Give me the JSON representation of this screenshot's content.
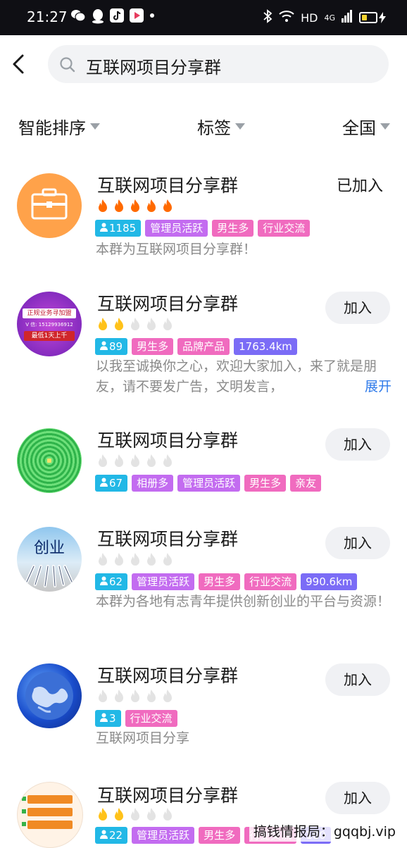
{
  "status": {
    "time": "21:27",
    "right_icons": [
      "bluetooth-icon",
      "wifi-icon",
      "HD",
      "4G",
      "signal-icon",
      "battery-icon"
    ],
    "battery_level": 0.4
  },
  "search": {
    "query": "互联网项目分享群"
  },
  "filters": [
    {
      "label": "智能排序"
    },
    {
      "label": "标签"
    },
    {
      "label": "全国"
    }
  ],
  "groups": [
    {
      "title": "互联网项目分享群",
      "fires_active": 5,
      "fire_color": "#ff6a00",
      "count": "1185",
      "tags": [
        {
          "text": "管理员活跃",
          "color": "#c36cf0"
        },
        {
          "text": "男生多",
          "color": "#f06bbf"
        },
        {
          "text": "行业交流",
          "color": "#f06bbf"
        }
      ],
      "desc": "本群为互联网项目分享群！",
      "action": "已加入"
    },
    {
      "title": "互联网项目分享群",
      "fires_active": 2,
      "fire_color": "#ffc21a",
      "count": "89",
      "tags": [
        {
          "text": "男生多",
          "color": "#f06bbf"
        },
        {
          "text": "品牌产品",
          "color": "#f06bbf"
        },
        {
          "text": "1763.4km",
          "color": "#7b6cf6"
        }
      ],
      "desc": "以我至诚换你之心，欢迎大家加入，来了就是朋友，请不要发广告，文明发言，",
      "expand": "展开",
      "action": "加入",
      "avatar_text": {
        "line1": "正规业务寻加盟",
        "line2": "V 信: 15129936912",
        "line3": "最低1天上千"
      }
    },
    {
      "title": "互联网项目分享群",
      "fires_active": 0,
      "fire_color": "#ffc21a",
      "count": "67",
      "tags": [
        {
          "text": "相册多",
          "color": "#c36cf0"
        },
        {
          "text": "管理员活跃",
          "color": "#c36cf0"
        },
        {
          "text": "男生多",
          "color": "#f06bbf"
        },
        {
          "text": "亲友",
          "color": "#f06bbf"
        }
      ],
      "desc": "",
      "action": "加入"
    },
    {
      "title": "互联网项目分享群",
      "fires_active": 0,
      "fire_color": "#ffc21a",
      "count": "62",
      "tags": [
        {
          "text": "管理员活跃",
          "color": "#c36cf0"
        },
        {
          "text": "男生多",
          "color": "#f06bbf"
        },
        {
          "text": "行业交流",
          "color": "#f06bbf"
        },
        {
          "text": "990.6km",
          "color": "#7b6cf6"
        }
      ],
      "desc": "本群为各地有志青年提供创新创业的平台与资源！",
      "action": "加入",
      "avatar_text": {
        "label": "创业"
      }
    },
    {
      "title": "互联网项目分享群",
      "fires_active": 0,
      "fire_color": "#ffc21a",
      "count": "3",
      "tags": [
        {
          "text": "行业交流",
          "color": "#f06bbf"
        }
      ],
      "desc": "互联网项目分享",
      "action": "加入"
    },
    {
      "title": "互联网项目分享群",
      "fires_active": 2,
      "fire_color": "#ffc21a",
      "count": "22",
      "tags": [
        {
          "text": "管理员活跃",
          "color": "#c36cf0"
        },
        {
          "text": "男生多",
          "color": "#f06bbf"
        },
        {
          "text": "行业交流",
          "color": "#f06bbf"
        },
        {
          "text": "100",
          "color": "#7b6cf6"
        }
      ],
      "desc": "",
      "action": "加入"
    }
  ],
  "watermark": "搞钱情报局：gqqbj.vip",
  "colors": {
    "count_tag": "#22b8e6",
    "fire_inactive": "#e3e3e3"
  }
}
